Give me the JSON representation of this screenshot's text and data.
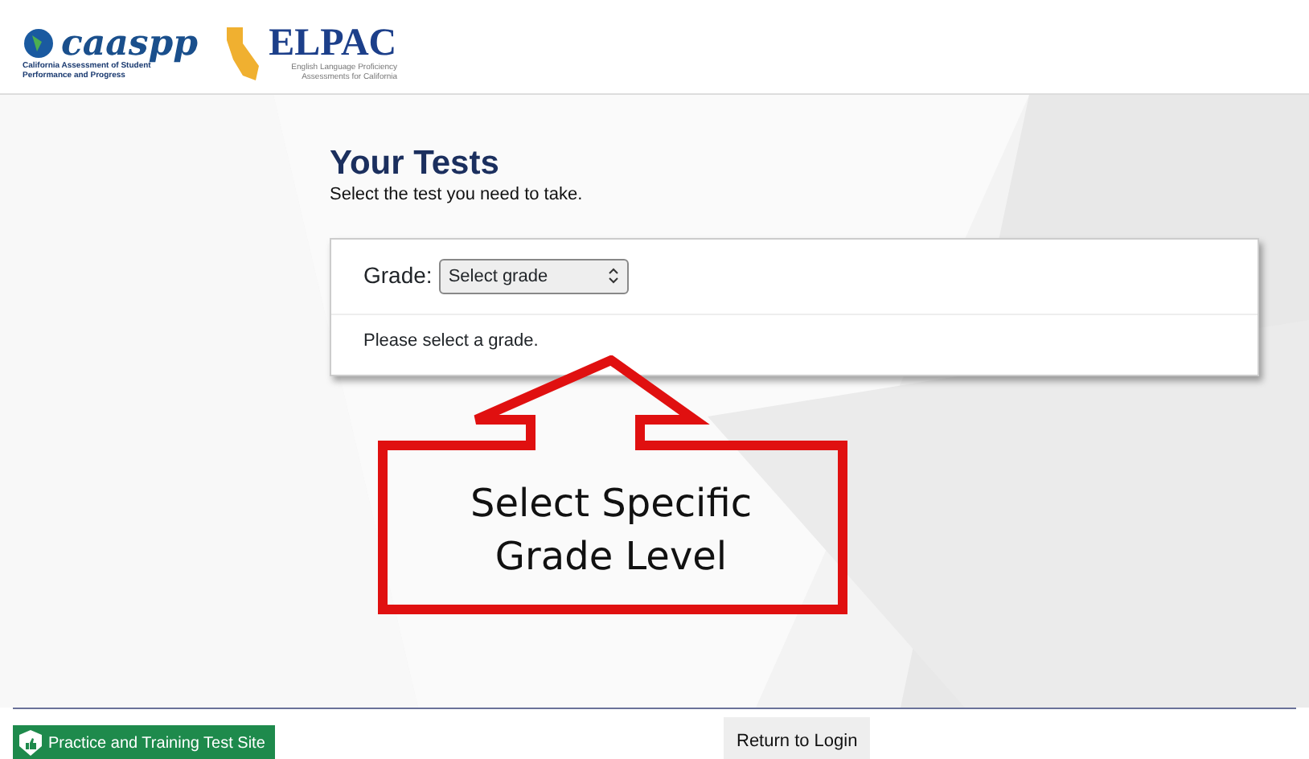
{
  "header": {
    "logo_caaspp": {
      "name": "caaspp",
      "subtitle": "California Assessment of Student Performance and Progress"
    },
    "logo_elpac": {
      "name": "ELPAC",
      "subtitle": "English Language Proficiency Assessments for California"
    }
  },
  "page": {
    "title": "Your Tests",
    "subtitle": "Select the test you need to take."
  },
  "grade_card": {
    "label": "Grade:",
    "select_value": "Select grade",
    "message": "Please select a grade."
  },
  "callout": {
    "text": "Select Specific Grade Level"
  },
  "footer": {
    "site_badge": "Practice and Training Test Site",
    "return_button": "Return to Login"
  }
}
